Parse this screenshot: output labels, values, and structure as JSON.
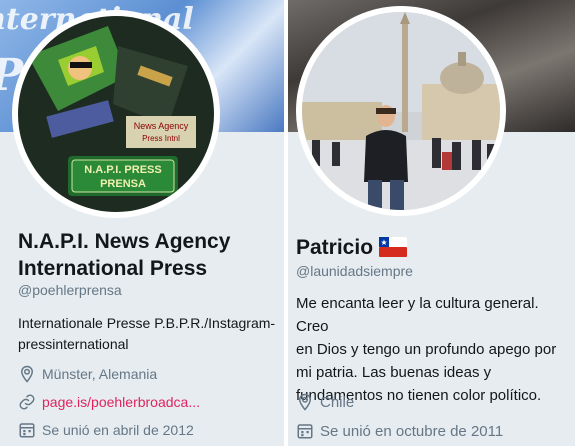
{
  "left_profile": {
    "banner_text_1": "International",
    "banner_text_2": "Press",
    "avatar_label_1": "News Agency",
    "avatar_label_2": "Press Intnl",
    "avatar_sign_1": "N.A.P.I. PRESS",
    "avatar_sign_2": "PRENSA",
    "name_line_1": "N.A.P.I. News Agency",
    "name_line_2": "International Press",
    "handle": "@poehlerprensa",
    "bio_line_1": "Internationale Presse P.B.P.R./Instagram-",
    "bio_line_2": "pressinternational",
    "location": "Münster, Alemania",
    "website": "page.is/poehlerbroadca...",
    "joined": "Se unió en abril de 2012",
    "icons": {
      "location": "location-pin-icon",
      "link": "link-icon",
      "joined": "calendar-icon"
    },
    "colors": {
      "link": "#e0245e"
    }
  },
  "right_profile": {
    "name": "Patricio",
    "flag": "chile-flag-icon",
    "handle": "@launidadsiempre",
    "bio_lines": [
      "Me encanta leer y la cultura general. Creo",
      "en Dios y tengo un profundo apego por",
      "mi patria. Las buenas ideas y",
      "fundamentos no tienen color político."
    ],
    "location": "Chile",
    "joined": "Se unió en octubre de 2011",
    "icons": {
      "location": "location-pin-icon",
      "joined": "calendar-icon"
    }
  }
}
